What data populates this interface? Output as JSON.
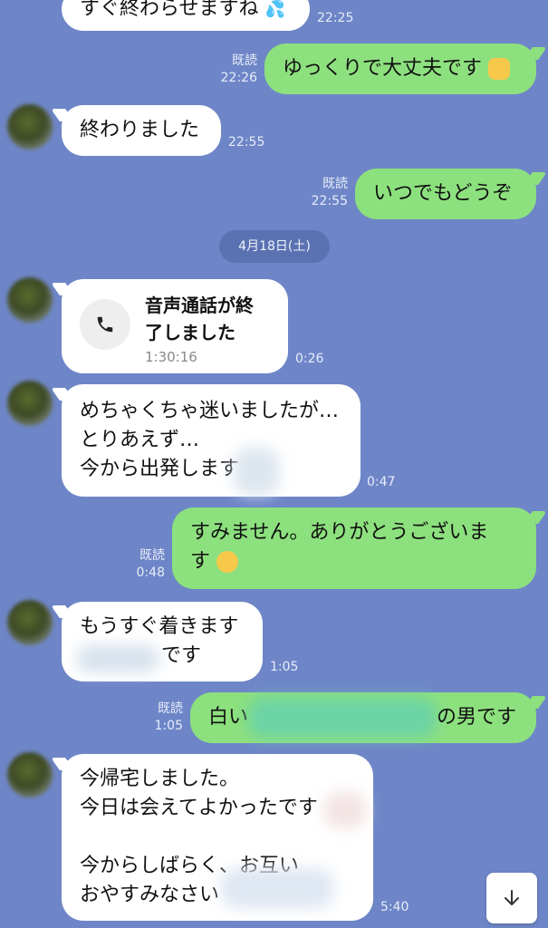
{
  "messages": {
    "m1": {
      "text": "すぐ終わらせますね",
      "time": "22:25"
    },
    "m2": {
      "text": "ゆっくりで大丈夫です",
      "read": "既読",
      "time": "22:26"
    },
    "m3": {
      "text": "終わりました",
      "time": "22:55"
    },
    "m4": {
      "text": "いつでもどうぞ",
      "read": "既読",
      "time": "22:55"
    },
    "date": "4月18日(土)",
    "m5": {
      "title_line1": "音声通話が終",
      "title_line2": "了しました",
      "duration": "1:30:16",
      "time": "0:26"
    },
    "m6": {
      "line1": "めちゃくちゃ迷いましたが…",
      "line2": "とりあえず…",
      "line3": "今から出発します",
      "time": "0:47"
    },
    "m7": {
      "line1": "すみません。ありがとうございま",
      "line2": "す",
      "read": "既読",
      "time": "0:48"
    },
    "m8": {
      "line1": "もうすぐ着きます",
      "line2": "です",
      "time": "1:05"
    },
    "m9": {
      "text_start": "白い",
      "text_end": "の男です",
      "read": "既読",
      "time": "1:05"
    },
    "m10": {
      "line1": "今帰宅しました。",
      "line2": "今日は会えてよかったです",
      "line3": "今からしばらく、お互い",
      "line4": "おやすみなさい",
      "time": "5:40"
    }
  },
  "icons": {
    "phone": "phone-icon",
    "scroll": "arrow-down-icon",
    "sweat": "sweat-drops-emoji",
    "ok": "ok-hand-emoji",
    "pleading": "pleading-face-emoji"
  },
  "colors": {
    "background": "#6e86c7",
    "incoming": "#ffffff",
    "outgoing": "#8de07e"
  }
}
